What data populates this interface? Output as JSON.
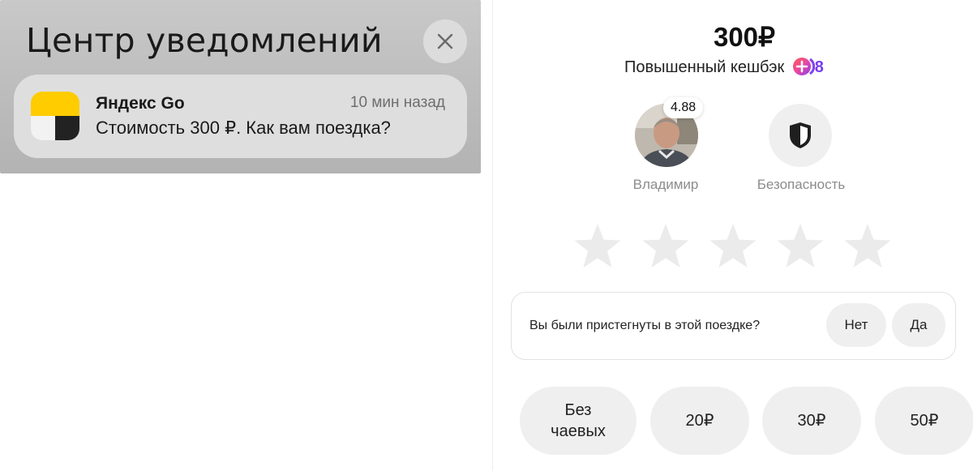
{
  "notification_center": {
    "title": "Центр уведомлений",
    "close_icon": "close-icon",
    "notification": {
      "app_name": "Яндекс Go",
      "time": "10 мин назад",
      "body": "Стоимость 300 ₽. Как вам поездка?",
      "app_icon": "yandex-go-app-icon",
      "icon_colors": {
        "top": "#ffcc00",
        "bottom_left": "#f2f2f2",
        "bottom_right": "#222222"
      }
    }
  },
  "ride_rating": {
    "price": "300₽",
    "cashback_label": "Повышенный кешбэк",
    "cashback_badge_value": "8",
    "driver": {
      "name": "Владимир",
      "rating": "4.88",
      "avatar": "driver-avatar"
    },
    "safety": {
      "label": "Безопасность",
      "icon": "shield-icon"
    },
    "stars": {
      "count": 5,
      "selected": 0,
      "icon": "star-icon"
    },
    "seatbelt": {
      "question": "Вы были пристегнуты в этой поездке?",
      "no_label": "Нет",
      "yes_label": "Да"
    },
    "tips": {
      "none_line1": "Без",
      "none_line2": "чаевых",
      "opt20": "20₽",
      "opt30": "30₽",
      "opt50": "50₽"
    }
  },
  "colors": {
    "notification_bg": "#bdbdbd",
    "star": "#ebebeb",
    "pill_bg": "#efefef",
    "cashback_accent": "#7a3cf0"
  }
}
